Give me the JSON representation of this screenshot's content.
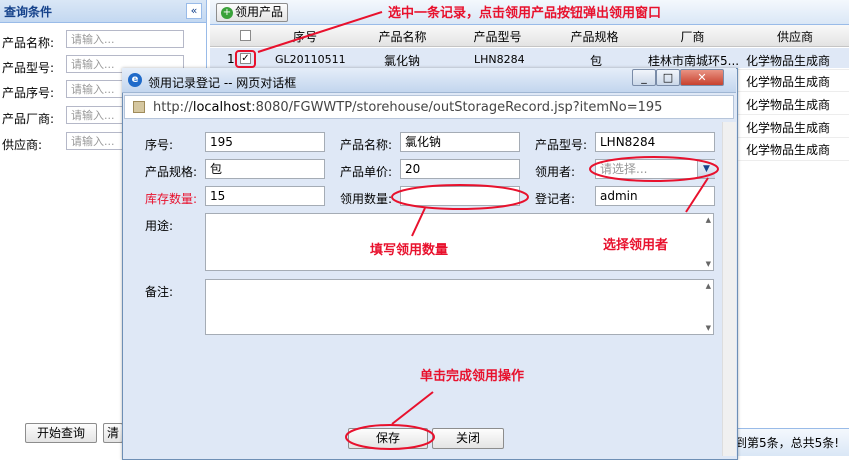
{
  "query_panel": {
    "title": "查询条件",
    "collapse_glyph": "«",
    "fields": [
      {
        "label": "产品名称:",
        "placeholder": "请输入..."
      },
      {
        "label": "产品型号:",
        "placeholder": "请输入..."
      },
      {
        "label": "产品序号:",
        "placeholder": "请输入..."
      },
      {
        "label": "产品厂商:",
        "placeholder": "请输入..."
      },
      {
        "label": "供应商:",
        "placeholder": "请输入..."
      }
    ],
    "search_button": "开始查询",
    "reset_button": "清"
  },
  "grid": {
    "toolbar": {
      "add_button": "领用产品",
      "add_icon": "plus-circle-icon"
    },
    "columns": [
      "序号",
      "产品名称",
      "产品型号",
      "产品规格",
      "厂商",
      "供应商"
    ],
    "rows": [
      {
        "index": "1",
        "checked": true,
        "serial": "GL20110511",
        "name": "氯化钠",
        "model": "LHN8284",
        "spec": "包",
        "maker": "桂林市南城环5...",
        "supplier": "化学物品生成商"
      },
      {
        "index": "",
        "checked": false,
        "serial": "",
        "name": "",
        "model": "",
        "spec": "",
        "maker": "",
        "supplier": "化学物品生成商"
      },
      {
        "index": "",
        "checked": false,
        "serial": "",
        "name": "",
        "model": "",
        "spec": "",
        "maker": "",
        "supplier": "化学物品生成商"
      },
      {
        "index": "",
        "checked": false,
        "serial": "",
        "name": "",
        "model": "",
        "spec": "",
        "maker": "",
        "supplier": "化学物品生成商"
      },
      {
        "index": "",
        "checked": false,
        "serial": "",
        "name": "",
        "model": "",
        "spec": "",
        "maker": "",
        "supplier": "化学物品生成商"
      }
    ],
    "pager_text": "到第5条，总共5条!"
  },
  "dialog": {
    "title": "领用记录登记 -- 网页对话框",
    "window_buttons": {
      "minimize": "_",
      "maximize": "□",
      "close": "✕"
    },
    "url_prefix": "http://",
    "url_host": "localhost",
    "url_rest": ":8080/FGWWTP/storehouse/outStorageRecord.jsp?itemNo=195",
    "form": {
      "serial_label": "序号:",
      "serial_value": "195",
      "name_label": "产品名称:",
      "name_value": "氯化钠",
      "model_label": "产品型号:",
      "model_value": "LHN8284",
      "spec_label": "产品规格:",
      "spec_value": "包",
      "price_label": "产品单价:",
      "price_value": "20",
      "receiver_label": "领用者:",
      "receiver_placeholder": "请选择...",
      "stock_label": "库存数量:",
      "stock_value": "15",
      "qty_label": "领用数量:",
      "qty_value": "",
      "registrar_label": "登记者:",
      "registrar_value": "admin",
      "purpose_label": "用途:",
      "remark_label": "备注:"
    },
    "save_button": "保存",
    "close_button": "关闭"
  },
  "annotations": {
    "select_record": "选中一条记录，点击领用产品按钮弹出领用窗口",
    "fill_qty": "填写领用数量",
    "choose_receiver": "选择领用者",
    "click_save": "单击完成领用操作"
  },
  "colors": {
    "annotation": "#e8112d",
    "panel_header": "#15428b",
    "stock_label": "#e8112d"
  }
}
